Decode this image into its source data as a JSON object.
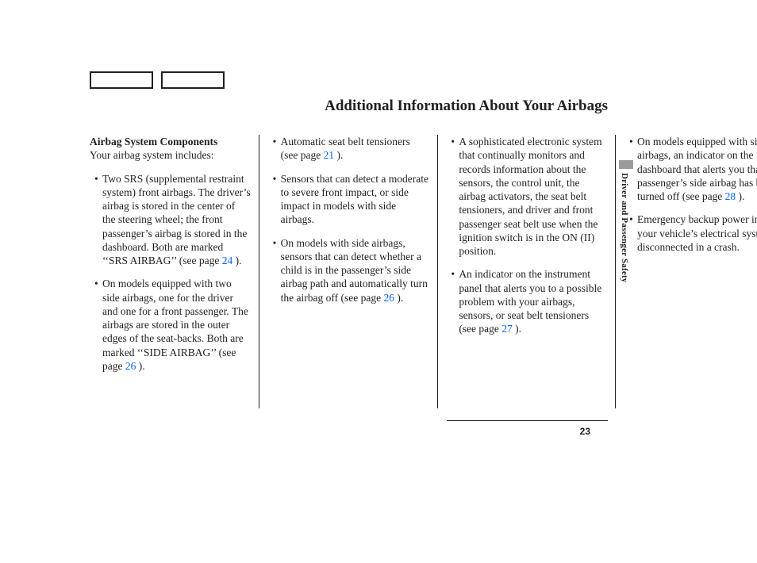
{
  "title": "Additional Information About Your Airbags",
  "section_heading": "Airbag System Components",
  "intro": "Your airbag system includes:",
  "side_label": "Driver and Passenger Safety",
  "page_number": "23",
  "items": {
    "i1a": "Two SRS (supplemental restraint system) front airbags. The driver’s airbag is stored in the center of the steering wheel; the front passenger’s airbag is stored in the dashboard. Both are marked ‘‘SRS AIRBAG’’ (see page ",
    "i1p": "24",
    "i1b": " ).",
    "i2a": "On models equipped with two side airbags, one for the driver and one for a front passenger. The airbags are stored in the outer edges of the seat-backs. Both are marked ‘‘SIDE AIRBAG’’ (see page ",
    "i2p": "26",
    "i2b": " ).",
    "i3a": "Automatic seat belt tensioners (see page ",
    "i3p": "21",
    "i3b": " ).",
    "i4": "Sensors that can detect a moderate to severe front impact, or side impact in models with side airbags.",
    "i5a": "On models with side airbags, sensors that can detect whether a child is in the passenger’s side airbag path and automatically turn the airbag off (see page ",
    "i5p": "26",
    "i5b": " ).",
    "i6": "A sophisticated electronic system that continually monitors and records information about the sensors, the control unit, the airbag activators, the seat belt tensioners, and driver and front passenger seat belt use when the ignition switch is in the ON (II) position.",
    "i7a": "An indicator on the instrument panel that alerts you to a possible problem with your airbags, sensors, or seat belt tensioners (see page ",
    "i7p": "27",
    "i7b": " ).",
    "i8a": "On models equipped with side airbags, an indicator on the dashboard that alerts you that the passenger’s side airbag has been turned off (see page ",
    "i8p": "28",
    "i8b": " ).",
    "i9": "Emergency backup power in case your vehicle’s electrical system is disconnected in a crash."
  }
}
